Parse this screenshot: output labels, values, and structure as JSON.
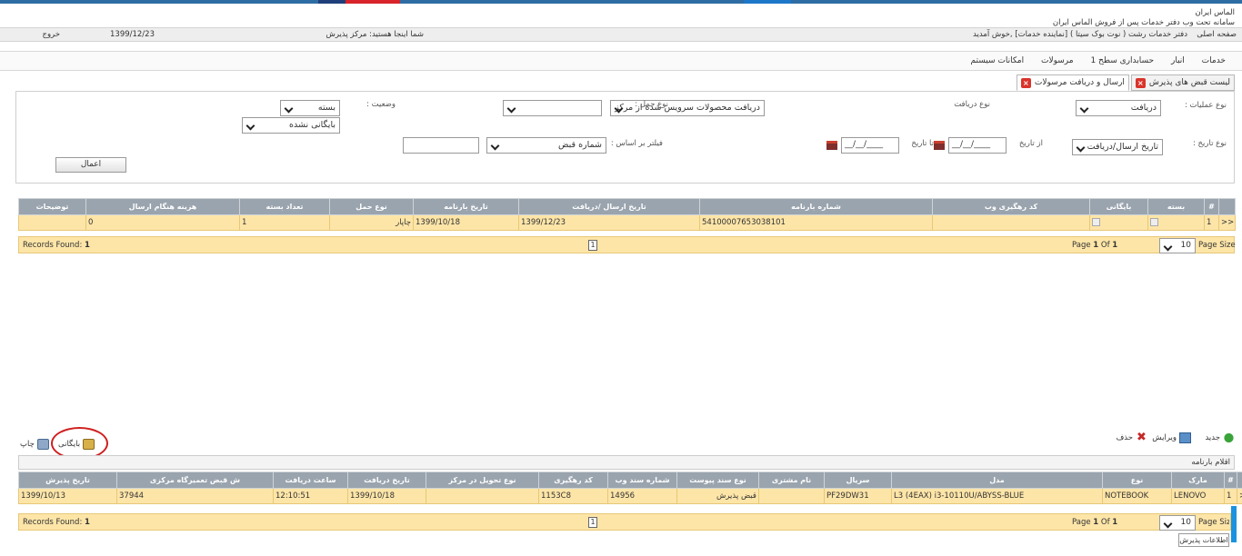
{
  "brand": {
    "line1": "الماس ایران",
    "line2": "سامانه تحت وب دفتر خدمات پس از فروش الماس ایران"
  },
  "infobar": {
    "home_link": "صفحه اصلی",
    "office": "دفتر خدمات رشت ( نوت بوک سیتا ) [نماینده خدمات] ,خوش آمدید",
    "location": "شما اینجا هستید: مرکز پذیرش",
    "date": "1399/12/23",
    "logout": "خروج"
  },
  "menu": {
    "items": [
      "خدمات",
      "انبار",
      "حسابداری سطح 1",
      "مرسولات",
      "امکانات سیستم"
    ]
  },
  "tabs": [
    {
      "label": "لیست قبض های پذیرش"
    },
    {
      "label": "ارسال و دریافت مرسولات"
    }
  ],
  "filters": {
    "op_type_label": "نوع عملیات :",
    "op_type_value": "دریافت",
    "receive_type_label": "نوع دریافت",
    "receive_type_value": "دریافت محصولات سرویس شده از مرکز",
    "carry_type_label": "نوع حمل :",
    "carry_type_value": "",
    "status_label": "وضعیت :",
    "status_value1": "بسته",
    "status_value2": "بایگانی نشده",
    "date_type_label": "نوع تاریخ :",
    "date_type_value": "تاریخ ارسال/دریافت",
    "from_date_label": "از تاریخ",
    "from_date_value": "__/__/____",
    "to_date_label": "تا تاریخ",
    "to_date_value": "__/__/____",
    "filter_by_label": "فیلتر بر اساس :",
    "filter_by_value": "شماره قبض",
    "apply_button": "اعمال"
  },
  "grid1": {
    "headers": [
      "",
      "#",
      "بسته",
      "بایگانی",
      "کد رهگیری وب",
      "شماره بارنامه",
      "تاریخ ارسال /دریافت",
      "تاریخ بارنامه",
      "نوع حمل",
      "تعداد بسته",
      "هزینه هنگام ارسال",
      "توضیحات"
    ],
    "rows": [
      {
        "expand": ">>",
        "idx": "1",
        "web_code": "",
        "waybill": "54100007653038101",
        "send_date": "1399/12/23",
        "waybill_date": "1399/10/18",
        "carry": "چاپار",
        "count": "1",
        "cost": "0",
        "notes": ""
      }
    ],
    "records_found_label": "Records Found:",
    "records_found": "1",
    "page_num": "1",
    "page_label": "Page",
    "page_current": "1",
    "page_of": "Of",
    "page_total": "1",
    "page_size_value": "10",
    "page_size_label": "Page Size"
  },
  "actions": {
    "new": "جدید",
    "edit": "ویرایش",
    "delete": "حذف",
    "archive": "بایگانی",
    "print": "چاپ"
  },
  "grid2": {
    "title": "اقلام بارنامه",
    "headers": [
      "",
      "#",
      "مارک",
      "نوع",
      "مدل",
      "سریال",
      "نام مشتری",
      "نوع سند پیوست",
      "شماره سند وب",
      "کد رهگیری",
      "نوع تحویل در مرکز",
      "تاریخ دریافت",
      "ساعت دریافت",
      "ش قبض تعمیرگاه مرکزی",
      "تاریخ پذیرش"
    ],
    "rows": [
      {
        "expand": ">>",
        "idx": "1",
        "brand": "LENOVO",
        "type": "NOTEBOOK",
        "model": "L3 (4EAX) i3-10110U/ABYSS-BLUE",
        "serial": "PF29DW31",
        "customer": "",
        "doc_type": "قبض پذیرش",
        "web_doc": "14956",
        "tracking": "1153C8",
        "delivery": "",
        "recv_date": "1399/10/18",
        "recv_time": "12:10:51",
        "central_receipt": "37944",
        "accept_date": "1399/10/13"
      }
    ],
    "records_found_label": "Records Found:",
    "records_found": "1",
    "page_num": "1",
    "page_label": "Page",
    "page_current": "1",
    "page_of": "Of",
    "page_total": "1",
    "page_size_value": "10",
    "page_size_label": "Page Size"
  },
  "footer_button": "اطلاعات پذیرش"
}
